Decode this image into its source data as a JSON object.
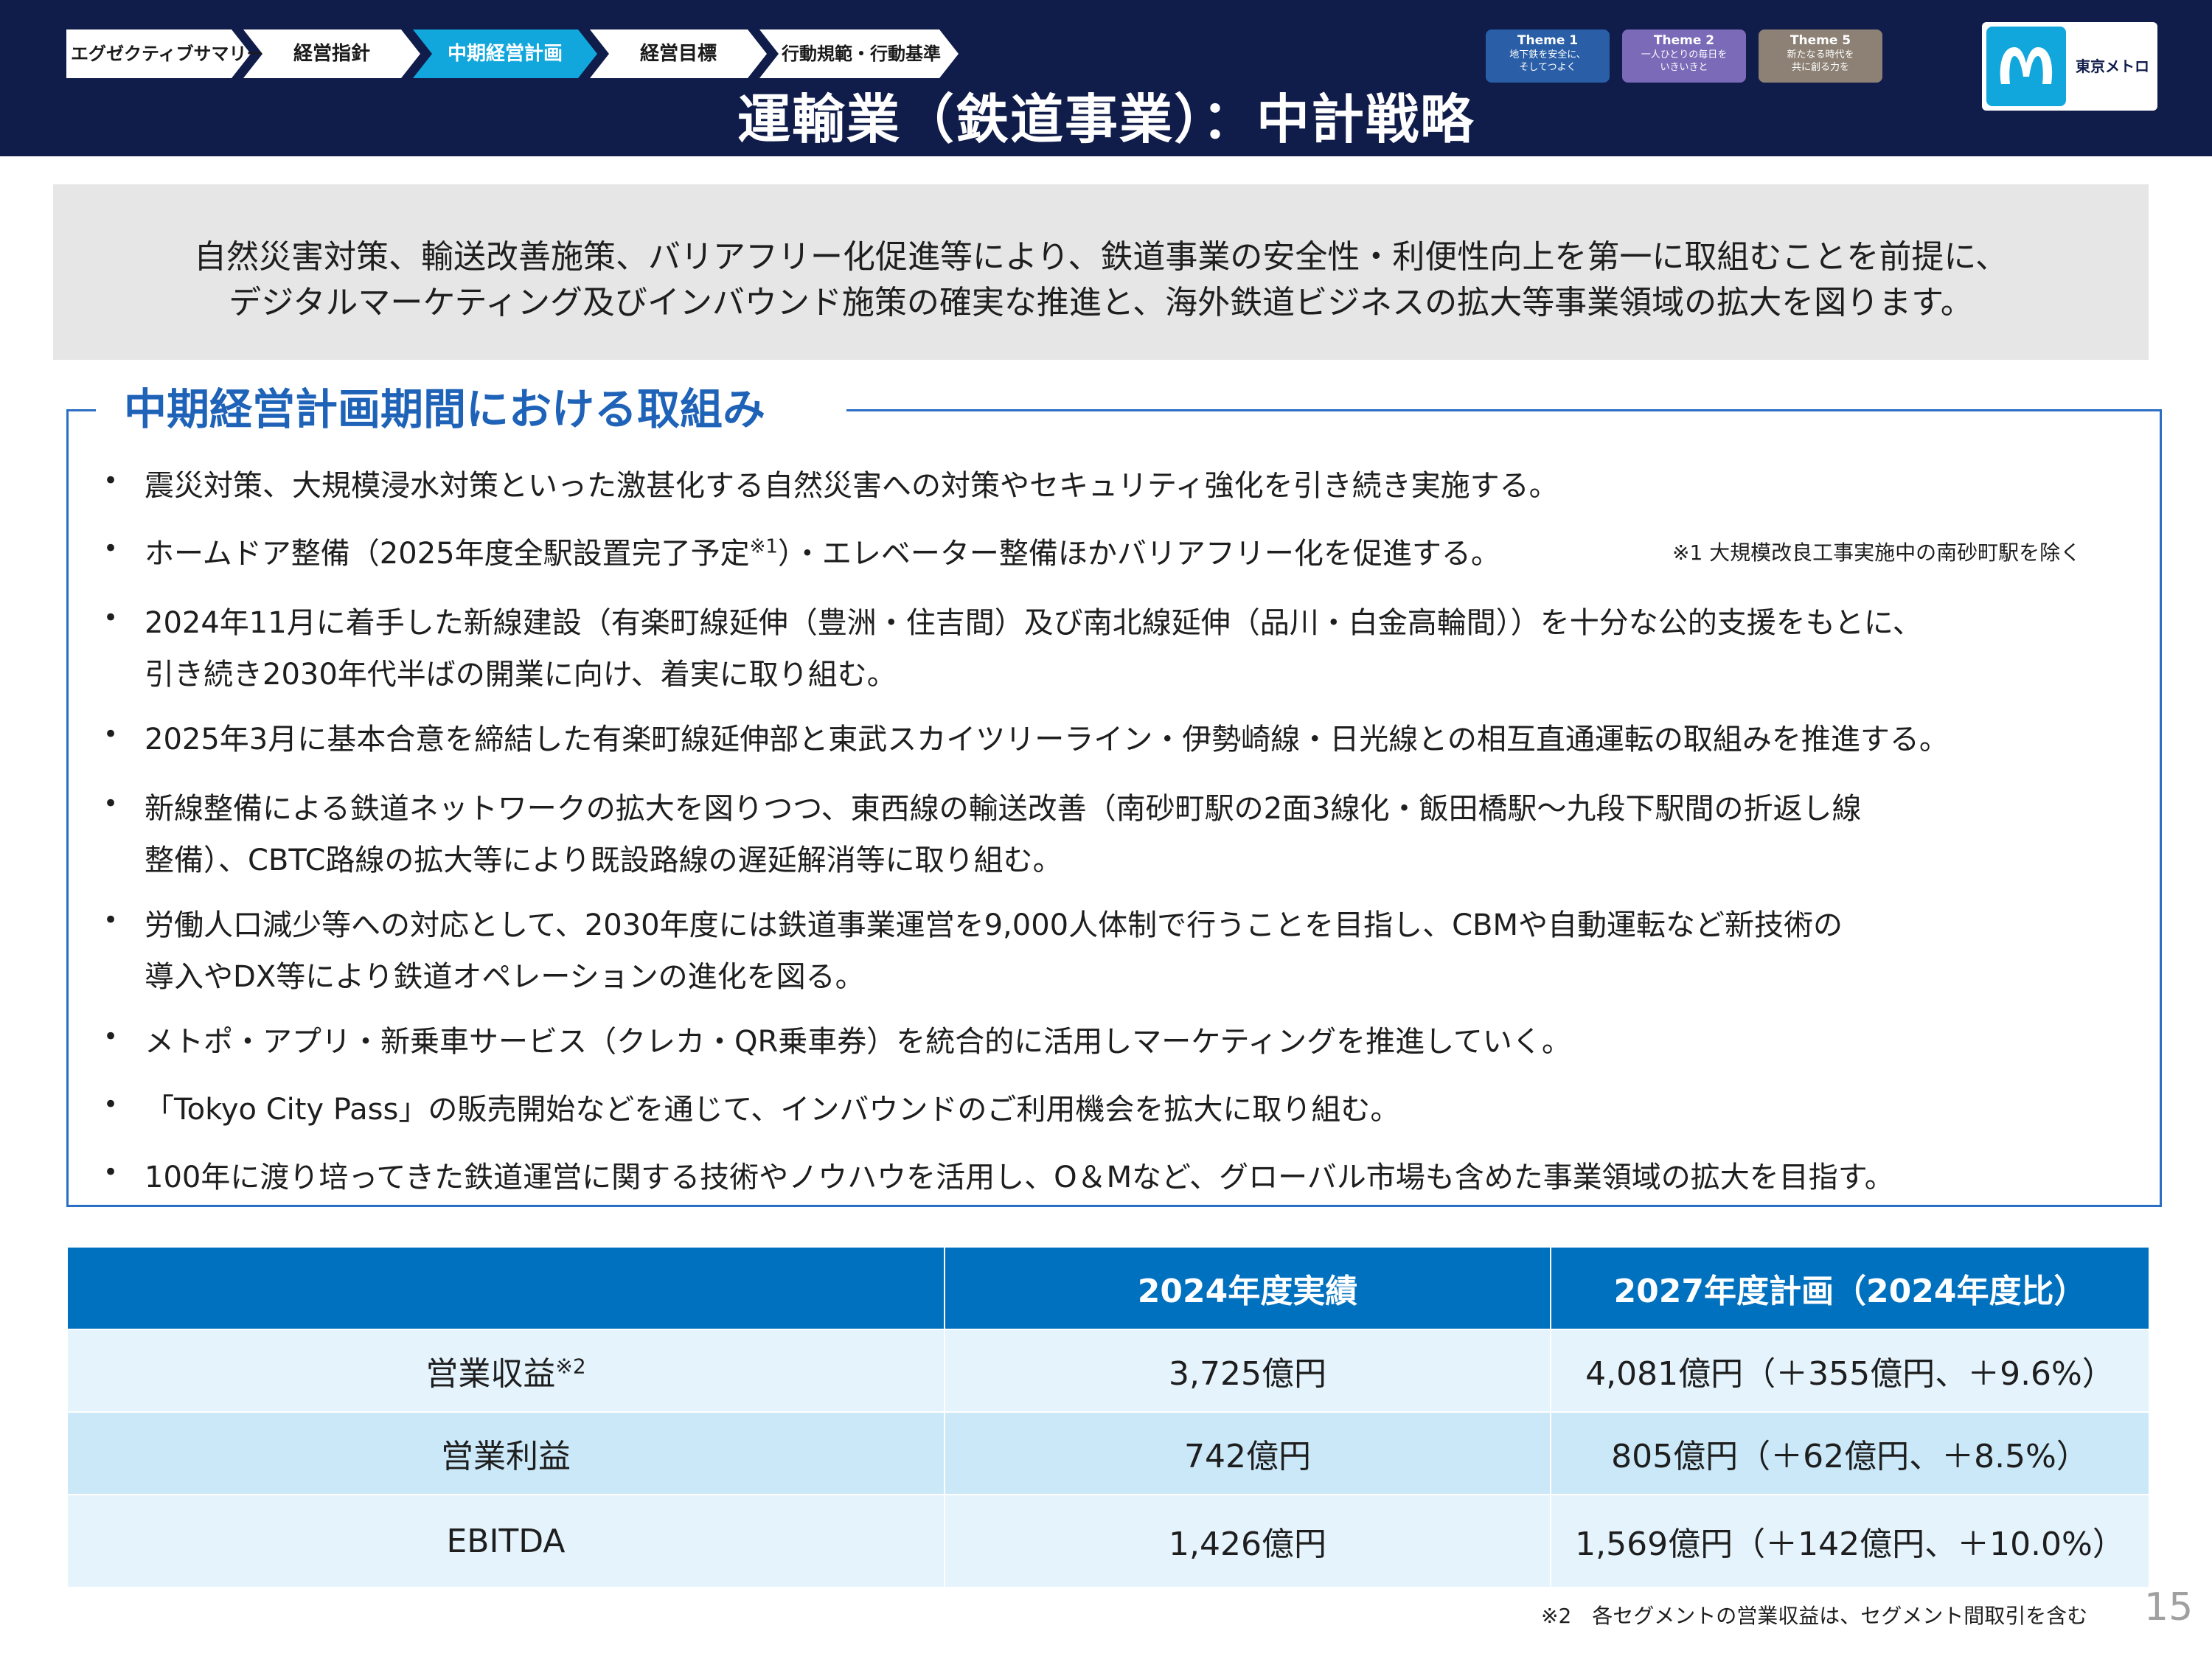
{
  "header": {
    "nav": [
      {
        "label": "エグゼクティブサマリー",
        "active": false
      },
      {
        "label": "経営指針",
        "active": false
      },
      {
        "label": "中期経営計画",
        "active": true
      },
      {
        "label": "経営目標",
        "active": false
      },
      {
        "label": "行動規範・行動基準",
        "active": false
      }
    ],
    "title": "運輸業（鉄道事業）：中計戦略",
    "themes": [
      {
        "name": "Theme 1",
        "lines": [
          "地下鉄を安全に、",
          "そしてつよく"
        ],
        "color": "#2a5fa8"
      },
      {
        "name": "Theme 2",
        "lines": [
          "一人ひとりの毎日を",
          "いきいきと"
        ],
        "color": "#7a6ab8"
      },
      {
        "name": "Theme 5",
        "lines": [
          "新たなる時代を",
          "共に創る力を"
        ],
        "color": "#8c8174"
      }
    ],
    "logo_text": "東京メトロ"
  },
  "intro": {
    "line1": "自然災害対策、輸送改善施策、バリアフリー化促進等により、鉄道事業の安全性・利便性向上を第一に取組むことを前提に、",
    "line2": "デジタルマーケティング及びインバウンド施策の確実な推進と、海外鉄道ビジネスの拡大等事業領域の拡大を図ります。"
  },
  "initiatives": {
    "title": "中期経営計画期間における取組み",
    "bullet_symbol": "•",
    "b1": "震災対策、大規模浸水対策といった激甚化する自然災害への対策やセキュリティ強化を引き続き実施する。",
    "b2_pre": "ホームドア整備（2025年度全駅設置完了予定",
    "b2_sup": "※1",
    "b2_post": "）・エレベーター整備ほかバリアフリー化を促進する。",
    "footnote1": "※1 大規模改良工事実施中の南砂町駅を除く",
    "b3_l1": "2024年11月に着手した新線建設（有楽町線延伸（豊洲・住吉間）及び南北線延伸（品川・白金高輪間））を十分な公的支援をもとに、",
    "b3_l2": "引き続き2030年代半ばの開業に向け、着実に取り組む。",
    "b4": "2025年3月に基本合意を締結した有楽町線延伸部と東武スカイツリーライン・伊勢崎線・日光線との相互直通運転の取組みを推進する。",
    "b5_l1": "新線整備による鉄道ネットワークの拡大を図りつつ、東西線の輸送改善（南砂町駅の2面3線化・飯田橋駅～九段下駅間の折返し線",
    "b5_l2": "整備）、CBTC路線の拡大等により既設路線の遅延解消等に取り組む。",
    "b6_l1": "労働人口減少等への対応として、2030年度には鉄道事業運営を9,000人体制で行うことを目指し、CBMや自動運転など新技術の",
    "b6_l2": "導入やDX等により鉄道オペレーションの進化を図る。",
    "b7": "メトポ・アプリ・新乗車サービス（クレカ・QR乗車券）を統合的に活用しマーケティングを推進していく。",
    "b8": "「Tokyo City Pass」の販売開始などを通じて、インバウンドのご利用機会を拡大に取り組む。",
    "b9": "100年に渡り培ってきた鉄道運営に関する技術やノウハウを活用し、O＆Mなど、グローバル市場も含めた事業領域の拡大を目指す。"
  },
  "table": {
    "headers": [
      "",
      "2024年度実績",
      "2027年度計画（2024年度比）"
    ],
    "rows": [
      {
        "label": "営業収益",
        "label_sup": "※2",
        "actual": "3,725億円",
        "plan": "4,081億円（＋355億円、＋9.6%）"
      },
      {
        "label": "営業利益",
        "label_sup": "",
        "actual": "742億円",
        "plan": "805億円（＋62億円、＋8.5%）"
      },
      {
        "label": "EBITDA",
        "label_sup": "",
        "actual": "1,426億円",
        "plan": "1,569億円（＋142億円、＋10.0%）"
      }
    ]
  },
  "footnote2": "※2　各セグメントの営業収益は、セグメント間取引を含む",
  "page_number": "15"
}
